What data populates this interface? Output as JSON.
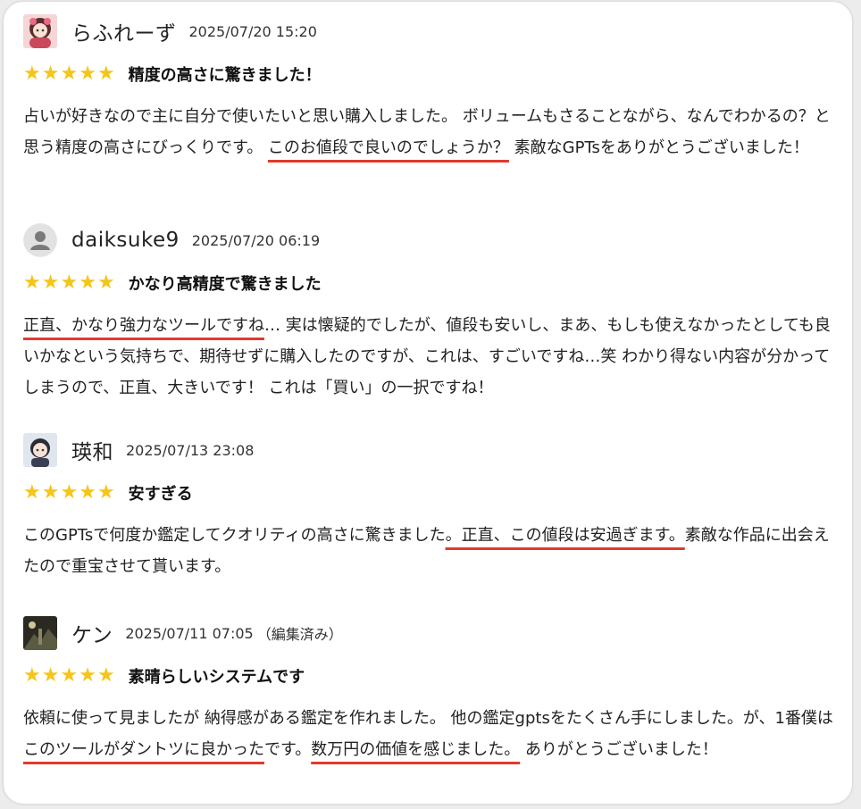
{
  "reviews": [
    {
      "username": "らふれーず",
      "date": "2025/07/20 15:20",
      "edited": "",
      "title": "精度の高さに驚きました！",
      "stars": 5,
      "avatar_icon": "anime-girl-avatar-icon",
      "body": [
        {
          "text": "占いが好きなので主に自分で使いたいと思い購入しました。 ボリュームもさることながら、なんでわかるの？と思う精度の高さにびっくりです。 ",
          "hl": false
        },
        {
          "text": "このお値段で良いのでしょうか？",
          "hl": true
        },
        {
          "text": " 素敵なGPTsをありがとうございました！",
          "hl": false
        }
      ]
    },
    {
      "username": "daiksuke9",
      "date": "2025/07/20 06:19",
      "edited": "",
      "title": "かなり高精度で驚きました",
      "stars": 5,
      "avatar_icon": "default-user-avatar-icon",
      "body": [
        {
          "text": "正直、かなり強力なツールですね",
          "hl": true
        },
        {
          "text": "… 実は懐疑的でしたが、値段も安いし、まあ、もしも使えなかったとしても良いかなという気持ちで、期待せずに購入したのですが、これは、すごいですね…笑 わかり得ない内容が分かってしまうので、正直、大きいです！ これは「買い」の一択ですね！",
          "hl": false
        }
      ]
    },
    {
      "username": "瑛和",
      "date": "2025/07/13 23:08",
      "edited": "",
      "title": "安すぎる",
      "stars": 5,
      "avatar_icon": "anime-boy-avatar-icon",
      "body": [
        {
          "text": "このGPTsで何度か鑑定してクオリティの高さに驚きました",
          "hl": false
        },
        {
          "text": "。正直、この値段は安過ぎます。",
          "hl": true
        },
        {
          "text": "素敵な作品に出会えたので重宝させて貰います。",
          "hl": false
        }
      ]
    },
    {
      "username": "ケン",
      "date": "2025/07/11 07:05",
      "edited": "（編集済み）",
      "title": "素晴らしいシステムです",
      "stars": 5,
      "avatar_icon": "photo-avatar-icon",
      "body": [
        {
          "text": "依頼に使って見ましたが 納得感がある鑑定を作れました。 他の鑑定gptsをたくさん手にしました。が、1番僕は",
          "hl": false
        },
        {
          "text": "このツールがダントツに良かった",
          "hl": true
        },
        {
          "text": "です。",
          "hl": false
        },
        {
          "text": "数万円の価値を感じました。",
          "hl": true
        },
        {
          "text": " ありがとうございました！",
          "hl": false
        }
      ]
    }
  ],
  "colors": {
    "star": "#f5c518",
    "highlight_underline": "#e23a2a"
  }
}
